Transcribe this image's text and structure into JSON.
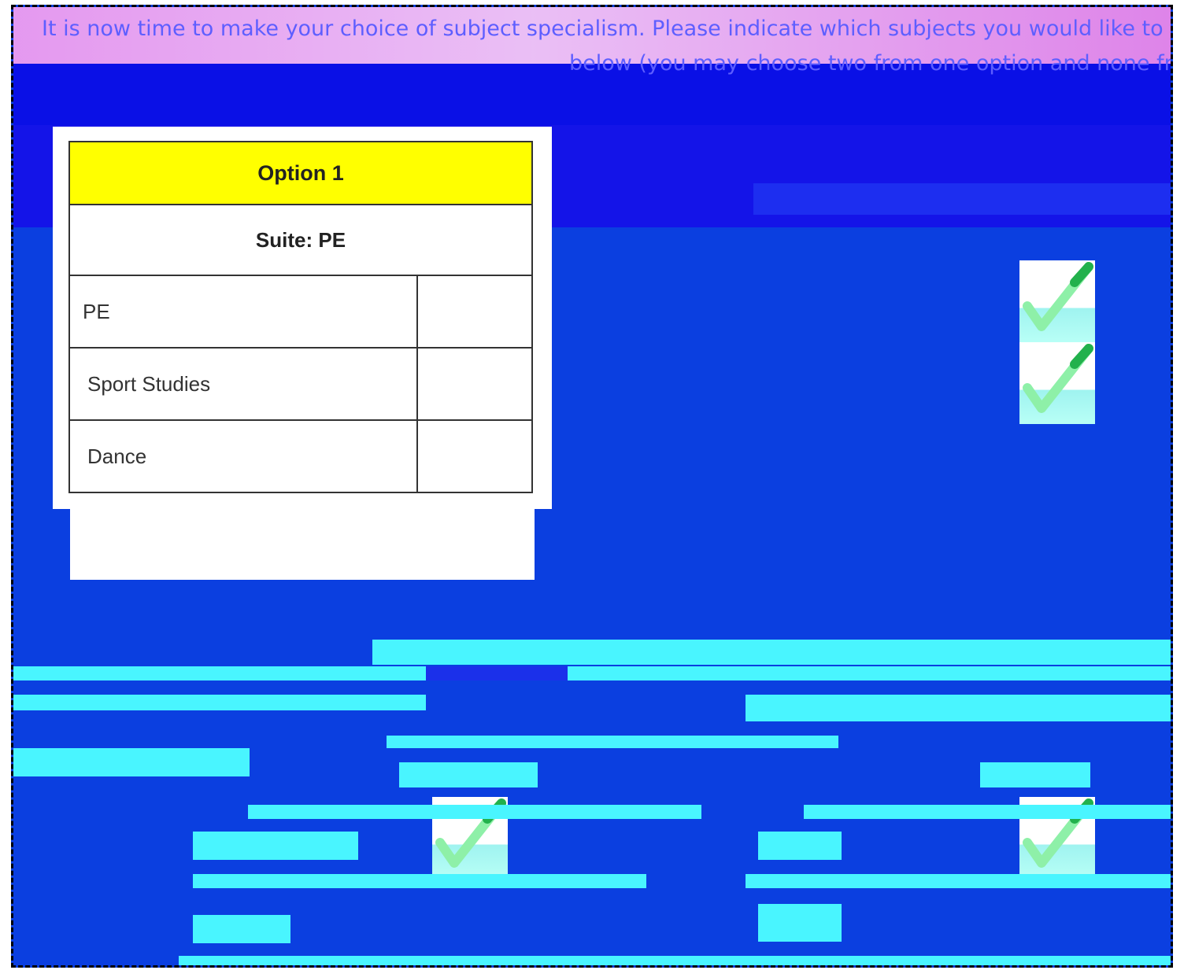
{
  "intro": {
    "line1": "It is now time to make your choice of subject specialism. Please indicate which subjects you would like to do",
    "line2": "below (you may choose two from one option and none fro"
  },
  "option_card": {
    "header": "Option 1",
    "suite": "Suite: PE",
    "subjects": [
      {
        "label": "PE"
      },
      {
        "label": "Sport Studies"
      },
      {
        "label": "Dance"
      }
    ]
  },
  "colors": {
    "header_bg": "#ffff00",
    "page_bg": "#0b3fe0",
    "check_green": "#22b14c"
  },
  "icons": [
    "checkmark-icon",
    "checkmark-icon",
    "checkmark-icon",
    "checkmark-icon"
  ]
}
